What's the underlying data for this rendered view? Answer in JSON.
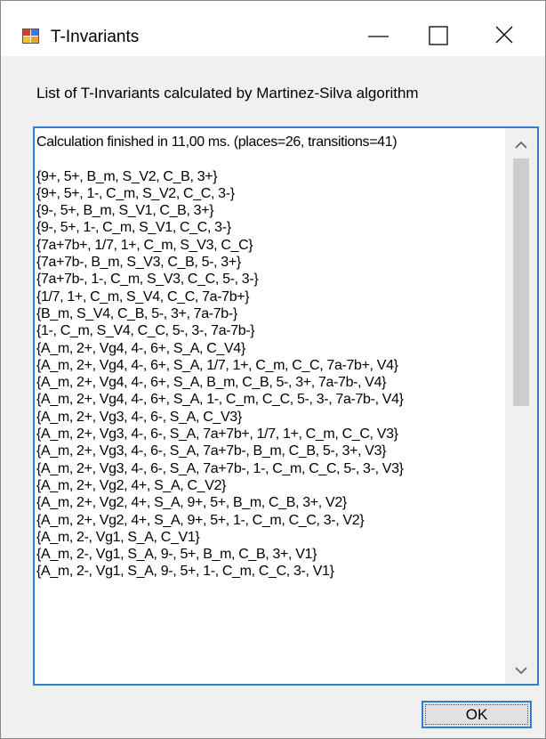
{
  "window": {
    "title": "T-Invariants",
    "app_icon": "t-invariants-app-icon",
    "controls": {
      "minimize_icon": "minimize-icon",
      "maximize_icon": "maximize-icon",
      "close_icon": "close-icon"
    }
  },
  "heading": "List of T-Invariants calculated by Martinez-Silva algorithm",
  "results": {
    "lines": [
      "Calculation finished in 11,00 ms. (places=26, transitions=41)",
      "",
      "{9+, 5+, B_m, S_V2, C_B, 3+}",
      "{9+, 5+, 1-, C_m, S_V2, C_C, 3-}",
      "{9-, 5+, B_m, S_V1, C_B, 3+}",
      "{9-, 5+, 1-, C_m, S_V1, C_C, 3-}",
      "{7a+7b+, 1/7, 1+, C_m, S_V3, C_C}",
      "{7a+7b-, B_m, S_V3, C_B, 5-, 3+}",
      "{7a+7b-, 1-, C_m, S_V3, C_C, 5-, 3-}",
      "{1/7, 1+, C_m, S_V4, C_C, 7a-7b+}",
      "{B_m, S_V4, C_B, 5-, 3+, 7a-7b-}",
      "{1-, C_m, S_V4, C_C, 5-, 3-, 7a-7b-}",
      "{A_m, 2+, Vg4, 4-, 6+, S_A, C_V4}",
      "{A_m, 2+, Vg4, 4-, 6+, S_A, 1/7, 1+, C_m, C_C, 7a-7b+, V4}",
      "{A_m, 2+, Vg4, 4-, 6+, S_A, B_m, C_B, 5-, 3+, 7a-7b-, V4}",
      "{A_m, 2+, Vg4, 4-, 6+, S_A, 1-, C_m, C_C, 5-, 3-, 7a-7b-, V4}",
      "{A_m, 2+, Vg3, 4-, 6-, S_A, C_V3}",
      "{A_m, 2+, Vg3, 4-, 6-, S_A, 7a+7b+, 1/7, 1+, C_m, C_C, V3}",
      "{A_m, 2+, Vg3, 4-, 6-, S_A, 7a+7b-, B_m, C_B, 5-, 3+, V3}",
      "{A_m, 2+, Vg3, 4-, 6-, S_A, 7a+7b-, 1-, C_m, C_C, 5-, 3-, V3}",
      "{A_m, 2+, Vg2, 4+, S_A, C_V2}",
      "{A_m, 2+, Vg2, 4+, S_A, 9+, 5+, B_m, C_B, 3+, V2}",
      "{A_m, 2+, Vg2, 4+, S_A, 9+, 5+, 1-, C_m, C_C, 3-, V2}",
      "{A_m, 2-, Vg1, S_A, C_V1}",
      "{A_m, 2-, Vg1, S_A, 9-, 5+, B_m, C_B, 3+, V1}",
      "{A_m, 2-, Vg1, S_A, 9-, 5+, 1-, C_m, C_C, 3-, V1}"
    ]
  },
  "scrollbar": {
    "up_icon": "scroll-up-arrow-icon",
    "down_icon": "scroll-down-arrow-icon"
  },
  "ok_button": {
    "label": "OK"
  },
  "colors": {
    "accent": "#2f7fd0",
    "titlebar": "#ffffff",
    "window": "#f0f0f0",
    "thumb": "#cdcdcd"
  }
}
